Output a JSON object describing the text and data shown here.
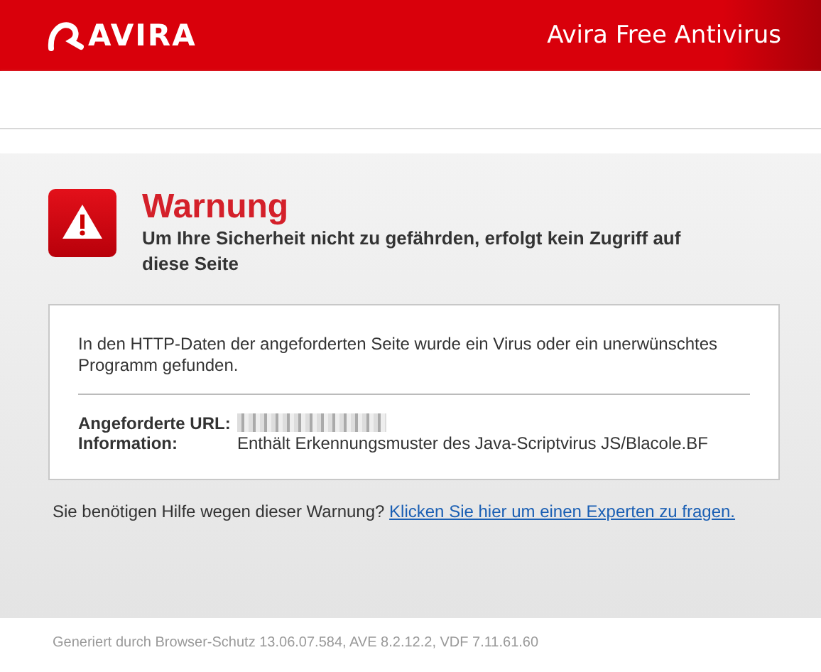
{
  "header": {
    "logo": "AVIRA",
    "product": "Avira Free Antivirus"
  },
  "warning": {
    "title": "Warnung",
    "subtitle": "Um Ihre Sicherheit nicht zu gefährden, erfolgt kein Zugriff auf diese Seite"
  },
  "details": {
    "message": "In den HTTP-Daten der angeforderten Seite wurde ein Virus oder ein unerwünschtes Programm gefunden.",
    "rows": [
      {
        "label": "Angeforderte URL:",
        "kind": "redacted"
      },
      {
        "label": "Information:",
        "kind": "text",
        "value": "Enthält Erkennungsmuster des Java-Scriptvirus JS/Blacole.BF"
      }
    ]
  },
  "help": {
    "text": "Sie benötigen Hilfe wegen dieser Warnung?",
    "link": "Klicken Sie hier um einen Experten zu fragen."
  },
  "footer": "Generiert durch Browser-Schutz 13.06.07.584, AVE 8.2.12.2, VDF 7.11.61.60"
}
